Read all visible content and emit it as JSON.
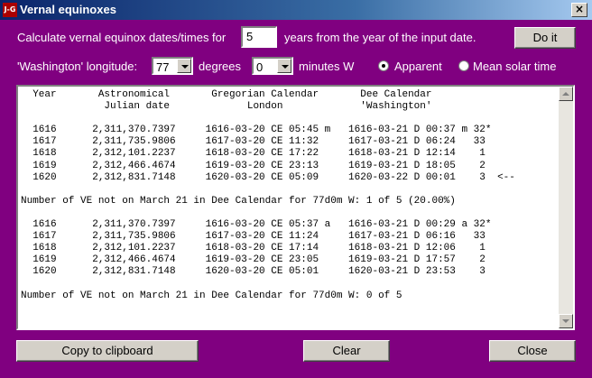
{
  "window": {
    "icon_text": "J-G",
    "title": "Vernal equinoxes",
    "close_glyph": "×"
  },
  "controls": {
    "calc_prefix": "Calculate vernal equinox dates/times for",
    "years_value": "5",
    "calc_suffix": "years from the year of the input date.",
    "do_it": "Do it",
    "longitude_label": "'Washington' longitude:",
    "degrees_value": "77",
    "degrees_label": "degrees",
    "minutes_value": "0",
    "minutes_label": "minutes W",
    "radio_apparent": "Apparent",
    "radio_mean": "Mean solar time",
    "selected_time": "Apparent"
  },
  "output": {
    "text": "  Year       Astronomical       Gregorian Calendar       Dee Calendar\n              Julian date             London             'Washington'\n\n  1616      2,311,370.7397     1616-03-20 CE 05:45 m   1616-03-21 D 00:37 m 32*\n  1617      2,311,735.9806     1617-03-20 CE 11:32     1617-03-21 D 06:24   33\n  1618      2,312,101.2237     1618-03-20 CE 17:22     1618-03-21 D 12:14    1\n  1619      2,312,466.4674     1619-03-20 CE 23:13     1619-03-21 D 18:05    2\n  1620      2,312,831.7148     1620-03-20 CE 05:09     1620-03-22 D 00:01    3  <--\n\nNumber of VE not on March 21 in Dee Calendar for 77d0m W: 1 of 5 (20.00%)\n\n  1616      2,311,370.7397     1616-03-20 CE 05:37 a   1616-03-21 D 00:29 a 32*\n  1617      2,311,735.9806     1617-03-20 CE 11:24     1617-03-21 D 06:16   33\n  1618      2,312,101.2237     1618-03-20 CE 17:14     1618-03-21 D 12:06    1\n  1619      2,312,466.4674     1619-03-20 CE 23:05     1619-03-21 D 17:57    2\n  1620      2,312,831.7148     1620-03-20 CE 05:01     1620-03-21 D 23:53    3\n\nNumber of VE not on March 21 in Dee Calendar for 77d0m W: 0 of 5"
  },
  "buttons": {
    "copy": "Copy to clipboard",
    "clear": "Clear",
    "close": "Close"
  }
}
